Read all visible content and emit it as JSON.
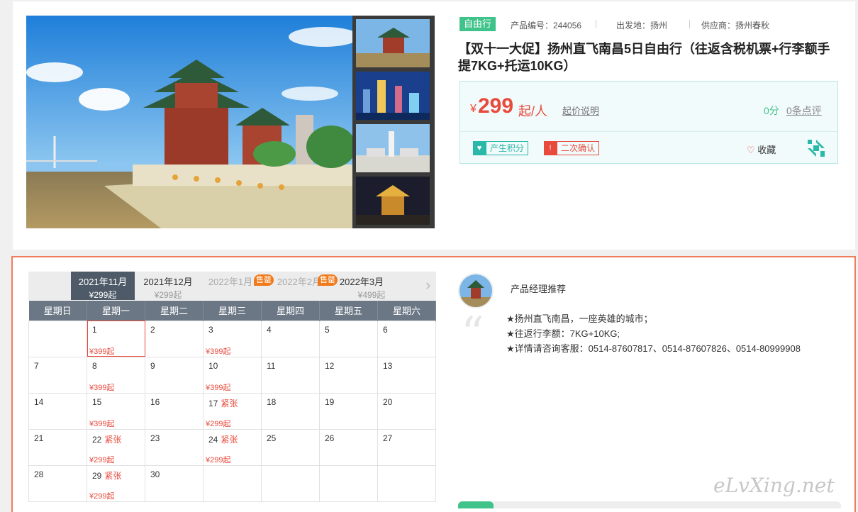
{
  "product": {
    "tag": "自由行",
    "code_label": "产品编号：244056",
    "origin_label": "出发地：扬州",
    "supplier_label": "供应商：扬州春秋",
    "title": "【双十一大促】扬州直飞南昌5日自由行（往返含税机票+行李额手提7KG+托运10KG）",
    "currency": "¥",
    "price": "299",
    "price_unit": "起/人",
    "price_explain": "起价说明",
    "score": "0分",
    "reviews": "0条点评",
    "badge_points": "产生积分",
    "badge_confirm": "二次确认",
    "favorite": "收藏"
  },
  "calendar": {
    "months": [
      {
        "label": "2021年11月",
        "price": "¥299起",
        "state": "active"
      },
      {
        "label": "2021年12月",
        "price": "¥299起",
        "state": "normal"
      },
      {
        "label": "2022年1月",
        "price": "",
        "state": "disabled",
        "badge": "售罄"
      },
      {
        "label": "2022年2月",
        "price": "",
        "state": "disabled",
        "badge": "售罄"
      },
      {
        "label": "2022年3月",
        "price": "¥499起",
        "state": "normal"
      }
    ],
    "weekdays": [
      "星期日",
      "星期一",
      "星期二",
      "星期三",
      "星期四",
      "星期五",
      "星期六"
    ],
    "weeks": [
      [
        {
          "d": ""
        },
        {
          "d": "1",
          "p": "¥399起",
          "sel": true
        },
        {
          "d": "2"
        },
        {
          "d": "3",
          "p": "¥399起"
        },
        {
          "d": "4"
        },
        {
          "d": "5"
        },
        {
          "d": "6"
        }
      ],
      [
        {
          "d": "7"
        },
        {
          "d": "8",
          "p": "¥399起"
        },
        {
          "d": "9"
        },
        {
          "d": "10",
          "p": "¥399起"
        },
        {
          "d": "11"
        },
        {
          "d": "12"
        },
        {
          "d": "13"
        }
      ],
      [
        {
          "d": "14"
        },
        {
          "d": "15",
          "p": "¥399起"
        },
        {
          "d": "16"
        },
        {
          "d": "17",
          "t": "紧张",
          "p": "¥299起"
        },
        {
          "d": "18"
        },
        {
          "d": "19"
        },
        {
          "d": "20"
        }
      ],
      [
        {
          "d": "21"
        },
        {
          "d": "22",
          "t": "紧张",
          "p": "¥299起"
        },
        {
          "d": "23"
        },
        {
          "d": "24",
          "t": "紧张",
          "p": "¥299起"
        },
        {
          "d": "25"
        },
        {
          "d": "26"
        },
        {
          "d": "27"
        }
      ],
      [
        {
          "d": "28"
        },
        {
          "d": "29",
          "t": "紧张",
          "p": "¥299起"
        },
        {
          "d": "30"
        },
        {
          "d": ""
        },
        {
          "d": ""
        },
        {
          "d": ""
        },
        {
          "d": ""
        }
      ]
    ]
  },
  "recommendation": {
    "title": "产品经理推荐",
    "lines": [
      "★扬州直飞南昌，一座英雄的城市；",
      "★往返行李额：7KG+10KG;",
      "★详情请咨询客服：0514-87607817、0514-87607826、0514-80999908"
    ]
  },
  "watermark": "eLvXing.net",
  "colors": {
    "accent_red": "#e84a3c",
    "accent_green": "#3fc38a",
    "border_orange": "#f07c5c",
    "header_dark": "#4e5a68"
  }
}
